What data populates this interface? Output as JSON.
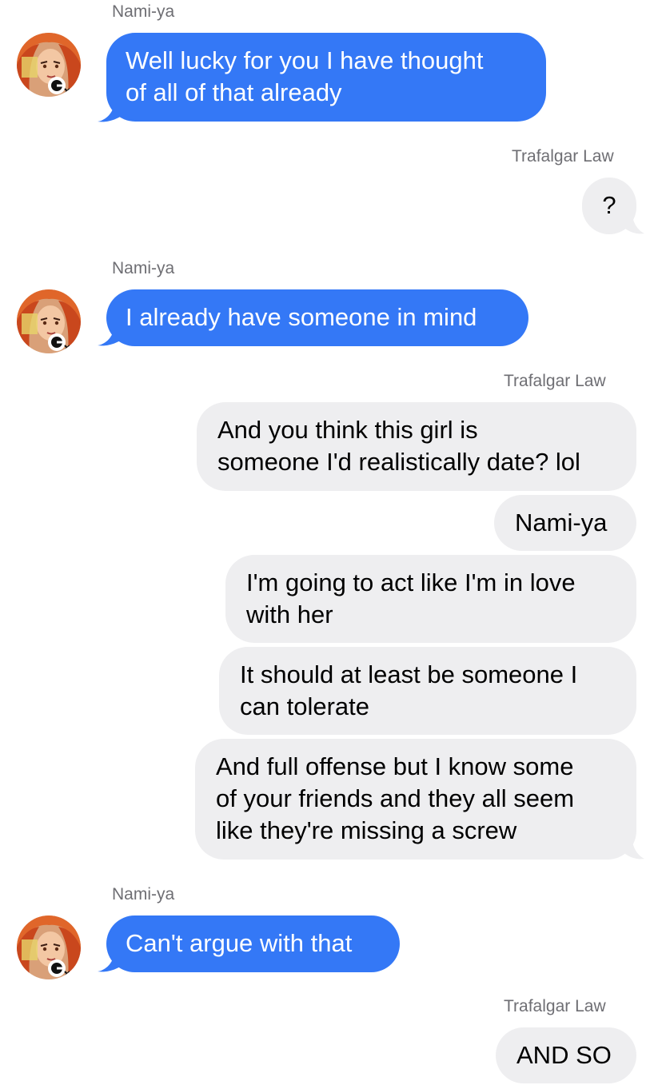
{
  "senders": {
    "nami": "Nami-ya",
    "law": "Trafalgar Law"
  },
  "messages": {
    "m1": [
      "Well lucky for you I have thought",
      "of all of that already"
    ],
    "m2": [
      "?"
    ],
    "m3": [
      "I already have someone in mind"
    ],
    "m4": [
      "And you think this girl is",
      "someone I'd realistically date? lol"
    ],
    "m5": [
      "Nami-ya"
    ],
    "m6": [
      "I'm going to act like I'm in love",
      "with her"
    ],
    "m7": [
      "It should at least be someone I",
      "can tolerate"
    ],
    "m8": [
      "And full offense but I know some",
      "of your friends and they all seem",
      "like they're missing a screw"
    ],
    "m9": [
      "Can't argue with that"
    ],
    "m10": [
      "AND SO"
    ]
  },
  "avatar": {
    "description_icon": "anime-character-avatar"
  },
  "colors": {
    "incoming_bubble": "#3478f6",
    "outgoing_bubble": "#eeeef0",
    "sender_name": "#6e6e73"
  }
}
